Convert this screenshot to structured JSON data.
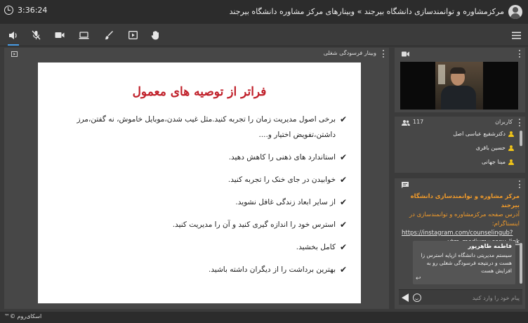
{
  "header": {
    "title": "مرکزمشاوره و توانمندسازی دانشگاه بیرجند » وبینارهای مرکز مشاوره دانشگاه بیرجند",
    "timer": "3:36:24"
  },
  "toolbar": {
    "items": [
      "speaker-icon",
      "mic-muted-icon",
      "camera-icon",
      "screen-share-icon",
      "brush-icon",
      "play-icon",
      "hand-icon",
      "menu-icon"
    ]
  },
  "main": {
    "title": "وبینار فرسودگی شغلی",
    "slide": {
      "title": "فراتر از توصیه های معمول",
      "bullets": [
        "برخی اصول مدیریت زمان را تجربه کنید.مثل غیب شدن،موبایل خاموش، نه گفتن،مرز داشتن،تفویض اختیار و....",
        "استاندارد های ذهنی را کاهش دهید.",
        "خوابیدن در جای خنک را تجربه کنید.",
        "از سایر ابعاد زندگی غافل نشوید.",
        "استرس خود را اندازه گیری کنید و آن را مدیریت کنید.",
        "کامل بخشید.",
        "بهترین برداشت را از دیگران داشته باشید."
      ]
    }
  },
  "users": {
    "title": "کاربران",
    "count": "117",
    "list": [
      "دکترشفیع عباسی اصل",
      "حسین باقری",
      "مینا جهانی"
    ]
  },
  "chat": {
    "msg1_sender": "مرکز مشاوره و توانمندسازی دانشگاه بیرجند",
    "msg1_text": "آدرس صفحه مرکزمشاوره و توانمندسازی در اینستاگرام:",
    "msg1_link1": "https://instagram.com/counselingub?",
    "msg1_link2": "utm_medium=copy_link",
    "msg2_sender": "فاطمه طاهرپور",
    "msg2_text": "سیستم مدیریتی دانشگاه ازپایه استرس زا هست و درنتیجه فرسودگی شغلی رو به افزایش هست",
    "reply_glyph": "↩",
    "input_placeholder": "پیام خود را وارد کنید"
  },
  "footer": {
    "brand": "اسکای‌روم ©™"
  }
}
